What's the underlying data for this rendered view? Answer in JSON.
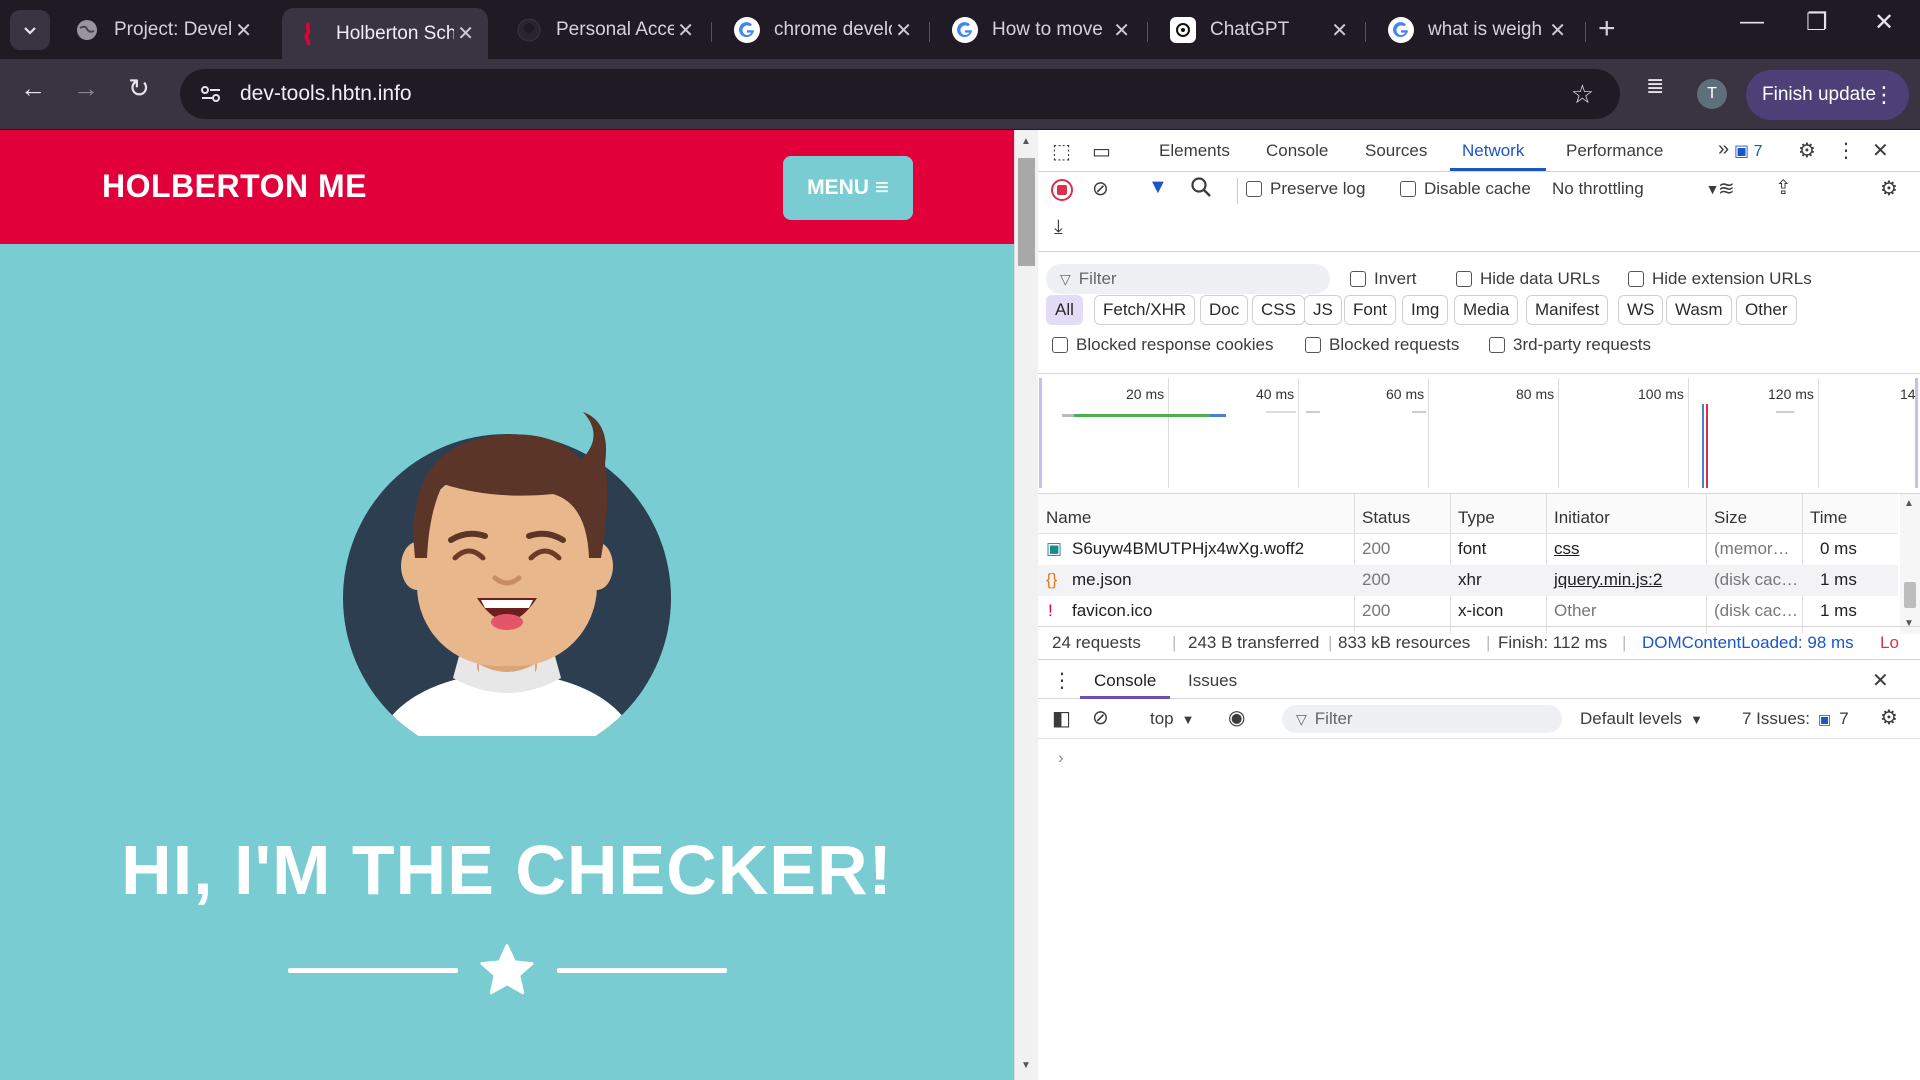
{
  "browser": {
    "tabs": [
      {
        "title": "Project: Devel",
        "favicon": "globe-icon"
      },
      {
        "title": "Holberton Sch",
        "favicon": "holberton-icon",
        "active": true
      },
      {
        "title": "Personal Acce",
        "favicon": "github-icon"
      },
      {
        "title": "chrome develo",
        "favicon": "google-icon"
      },
      {
        "title": "How to move",
        "favicon": "google-icon"
      },
      {
        "title": "ChatGPT",
        "favicon": "chatgpt-icon"
      },
      {
        "title": "what is weigh",
        "favicon": "google-icon"
      }
    ],
    "url": "dev-tools.hbtn.info",
    "profile_initial": "T",
    "finish_update_label": "Finish update"
  },
  "page": {
    "brand": "HOLBERTON ME",
    "menu_label": "MENU",
    "hero_title": "HI, I'M THE CHECKER!",
    "colors": {
      "header": "#e2003b",
      "background": "#79cdd2"
    }
  },
  "devtools": {
    "tabs": [
      "Elements",
      "Console",
      "Sources",
      "Network",
      "Performance"
    ],
    "active_tab": "Network",
    "issues_count": "7",
    "toolbar": {
      "preserve_log": "Preserve log",
      "disable_cache": "Disable cache",
      "throttling": "No throttling"
    },
    "filter": {
      "placeholder": "Filter",
      "invert": "Invert",
      "hide_data_urls": "Hide data URLs",
      "hide_extension_urls": "Hide extension URLs",
      "types": [
        "All",
        "Fetch/XHR",
        "Doc",
        "CSS",
        "JS",
        "Font",
        "Img",
        "Media",
        "Manifest",
        "WS",
        "Wasm",
        "Other"
      ],
      "blocked_cookies": "Blocked response cookies",
      "blocked_requests": "Blocked requests",
      "third_party": "3rd-party requests"
    },
    "timeline_ticks": [
      "20 ms",
      "40 ms",
      "60 ms",
      "80 ms",
      "100 ms",
      "120 ms",
      "14"
    ],
    "table": {
      "headers": [
        "Name",
        "Status",
        "Type",
        "Initiator",
        "Size",
        "Time"
      ],
      "rows": [
        {
          "name": "S6uyw4BMUTPHjx4wXg.woff2",
          "status": "200",
          "type": "font",
          "initiator": "css",
          "size": "(memor…",
          "time": "0 ms",
          "icon": "font-file-icon"
        },
        {
          "name": "me.json",
          "status": "200",
          "type": "xhr",
          "initiator": "jquery.min.js:2",
          "size": "(disk cac…",
          "time": "1 ms",
          "icon": "json-file-icon"
        },
        {
          "name": "favicon.ico",
          "status": "200",
          "type": "x-icon",
          "initiator": "Other",
          "size": "(disk cac…",
          "time": "1 ms",
          "icon": "holberton-icon"
        }
      ]
    },
    "summary": {
      "requests": "24 requests",
      "transferred": "243 B transferred",
      "resources": "833 kB resources",
      "finish": "Finish: 112 ms",
      "dom_content_loaded": "DOMContentLoaded: 98 ms",
      "load": "Lo"
    },
    "drawer": {
      "tabs": [
        "Console",
        "Issues"
      ],
      "context": "top",
      "filter_placeholder": "Filter",
      "levels": "Default levels",
      "issues_label": "7 Issues:",
      "issues_count": "7"
    }
  }
}
